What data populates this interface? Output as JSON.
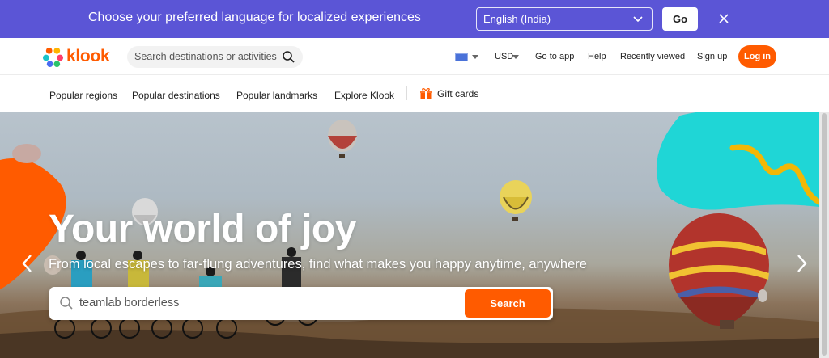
{
  "language_banner": {
    "message": "Choose your preferred language for localized experiences",
    "selected_language": "English (India)",
    "go_label": "Go"
  },
  "header": {
    "brand": "klook",
    "search_placeholder": "Search destinations or activities",
    "currency": "USD",
    "links": [
      "Go to app",
      "Help",
      "Recently viewed",
      "Sign up"
    ],
    "login_label": "Log in"
  },
  "nav": {
    "items": [
      "Popular regions",
      "Popular destinations",
      "Popular landmarks",
      "Explore Klook"
    ],
    "gift_cards": "Gift cards"
  },
  "hero": {
    "title": "Your world of joy",
    "subtitle": "From local escapes to far-flung adventures, find what makes you happy anytime, anywhere",
    "search_value": "teamlab borderless",
    "search_button": "Search"
  },
  "colors": {
    "banner": "#5b55d6",
    "brand_orange": "#ff5b00",
    "accent_teal": "#1fd6d6"
  }
}
